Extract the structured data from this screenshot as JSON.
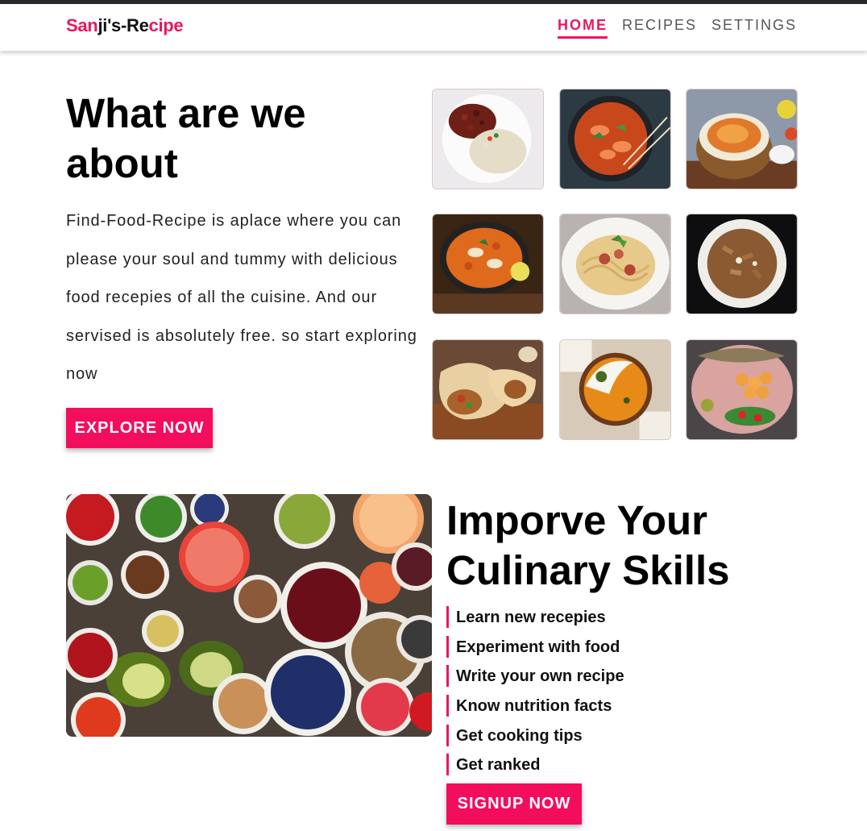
{
  "header": {
    "logo_parts": [
      "San",
      "ji's-",
      "Re",
      "cipe"
    ],
    "nav": [
      {
        "label": "HOME",
        "active": true
      },
      {
        "label": "RECIPES",
        "active": false
      },
      {
        "label": "SETTINGS",
        "active": false
      }
    ]
  },
  "about": {
    "title": "What are we about",
    "description": "Find-Food-Recipe is aplace where you can please your soul and tummy with delicious food recepies of all the cuisine. And our servised is absolutely free. so start exploring now",
    "button_label": "EXPLORE NOW"
  },
  "gallery": {
    "images": [
      "rice-and-beans-dish-image",
      "shrimp-curry-image",
      "biryani-image",
      "butter-chicken-image",
      "spaghetti-image",
      "penne-pasta-image",
      "burrito-wrap-image",
      "curry-rice-bowl-image",
      "grilled-fish-platter-image"
    ]
  },
  "skills": {
    "title": "Imporve Your Culinary Skills",
    "items": [
      "Learn new recepies",
      "Experiment with food",
      "Write your own recipe",
      "Know nutrition facts",
      "Get cooking tips",
      "Get ranked"
    ],
    "button_label": "SIGNUP NOW"
  },
  "colors": {
    "accent": "#e8175d",
    "button": "#f20d5d",
    "topbar": "#2a2a2e"
  }
}
